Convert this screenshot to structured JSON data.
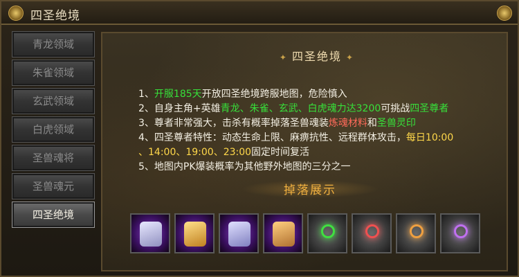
{
  "window": {
    "title": "四圣绝境"
  },
  "sidebar": {
    "items": [
      {
        "label": "青龙领域"
      },
      {
        "label": "朱雀领域"
      },
      {
        "label": "玄武领域"
      },
      {
        "label": "白虎领域"
      },
      {
        "label": "圣兽魂将"
      },
      {
        "label": "圣兽魂元"
      },
      {
        "label": "四圣绝境"
      }
    ]
  },
  "content": {
    "title": "四圣绝境",
    "rules": {
      "r1": {
        "pre": "1、",
        "green": "开服185天",
        "post": "开放四圣绝境跨服地图，危险慎入"
      },
      "r2": {
        "pre": "2、自身主角+英雄",
        "green": "青龙、朱雀、玄武、白虎魂力达3200",
        "mid": "可挑战",
        "green2": "四圣尊者"
      },
      "r3": {
        "pre": "3、尊者非常强大，击杀有概率掉落圣兽魂装",
        "orange": "炼魂材料",
        "mid": "和",
        "green": "圣兽灵印"
      },
      "r4": {
        "pre": "4、四圣尊者特性：动态生命上限、麻痹抗性、远程群体攻击，",
        "yellow": "每日10:00",
        "yellow2": "、14:00、19:00、23:00",
        "post": "固定时间复活"
      },
      "r5": {
        "text": "5、地图内PK爆装概率为其他野外地图的三分之一"
      }
    },
    "drops_title": "掉落展示",
    "drops": [
      {
        "icon": "beast-armor-icon",
        "bg": "purple",
        "color": "#d8d8f0"
      },
      {
        "icon": "beast-armor-icon",
        "bg": "purple",
        "color": "#f0c050"
      },
      {
        "icon": "beast-armor-icon",
        "bg": "purple",
        "color": "#c8c8e8"
      },
      {
        "icon": "beast-armor-icon",
        "bg": "purple",
        "color": "#e8b858"
      },
      {
        "icon": "seal-ring-icon",
        "bg": "grey",
        "color": "#40e040"
      },
      {
        "icon": "seal-ring-icon",
        "bg": "grey",
        "color": "#f05050"
      },
      {
        "icon": "seal-ring-icon",
        "bg": "grey",
        "color": "#f0a040"
      },
      {
        "icon": "seal-ring-icon",
        "bg": "grey",
        "color": "#c070f0"
      }
    ]
  }
}
